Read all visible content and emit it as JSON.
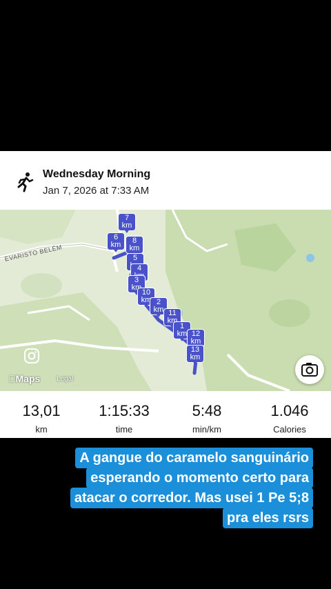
{
  "activity": {
    "title": "Wednesday Morning",
    "datetime": "Jan 7, 2026 at 7:33 AM",
    "icon": "running-person-icon"
  },
  "map": {
    "street_label": "EVARISTO BELÉM",
    "attribution": "Maps",
    "legal": "Legal",
    "route_color": "#4a52c9",
    "km_markers": [
      "7",
      "6",
      "8",
      "5",
      "4",
      "3",
      "10",
      "2",
      "11",
      "1",
      "12",
      "13"
    ],
    "km_unit": "km"
  },
  "stats": [
    {
      "value": "13,01",
      "unit": "km"
    },
    {
      "value": "1:15:33",
      "unit": "time"
    },
    {
      "value": "5:48",
      "unit": "min/km"
    },
    {
      "value": "1.046",
      "unit": "Calories"
    }
  ],
  "caption": {
    "lines": [
      "A gangue do caramelo sanguinário",
      "esperando o momento certo para",
      "atacar  o corredor.  Mas usei  1 Pe 5;8",
      "pra eles rsrs"
    ],
    "bg_color": "#1b8fd9"
  }
}
